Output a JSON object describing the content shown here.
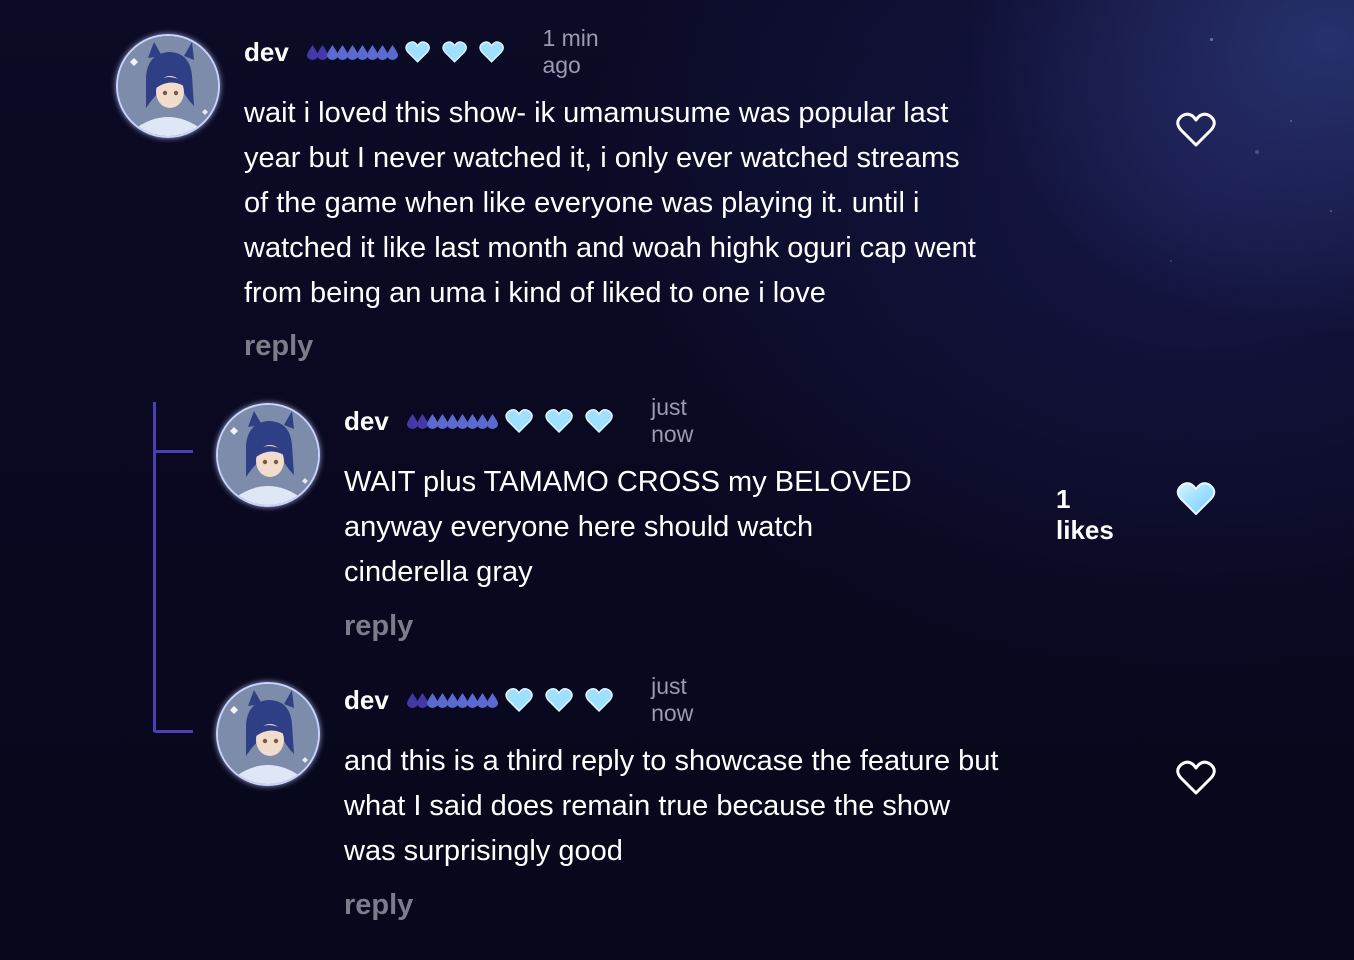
{
  "colors": {
    "thread_line": "#4a3fb5",
    "heart_fill": "#9fe0ff",
    "muted_text": "#7c7c8a",
    "time_text": "#9a9ab0"
  },
  "comments": [
    {
      "username": "dev",
      "time": "1 min ago",
      "lines": [
        "wait i loved this show- ik umamusume was popular last",
        "year but I never watched it, i only ever watched streams",
        "of the game when like everyone was playing it. until i",
        "watched it like last month and woah highk oguri cap went",
        "from being an uma i kind of liked to one i love"
      ],
      "reply_label": "reply",
      "like_icon": "heart-outline-icon",
      "likes_text": ""
    },
    {
      "username": "dev",
      "time": "just now",
      "lines": [
        "WAIT plus TAMAMO CROSS my BELOVED",
        "anyway everyone here should watch",
        "cinderella gray"
      ],
      "reply_label": "reply",
      "like_icon": "heart-filled-icon",
      "likes_text": "1 likes"
    },
    {
      "username": "dev",
      "time": "just now",
      "lines": [
        "and this is a third reply to showcase the feature but",
        "what I said does remain true because the show",
        "was surprisingly good"
      ],
      "reply_label": "reply",
      "like_icon": "heart-outline-icon",
      "likes_text": ""
    }
  ]
}
